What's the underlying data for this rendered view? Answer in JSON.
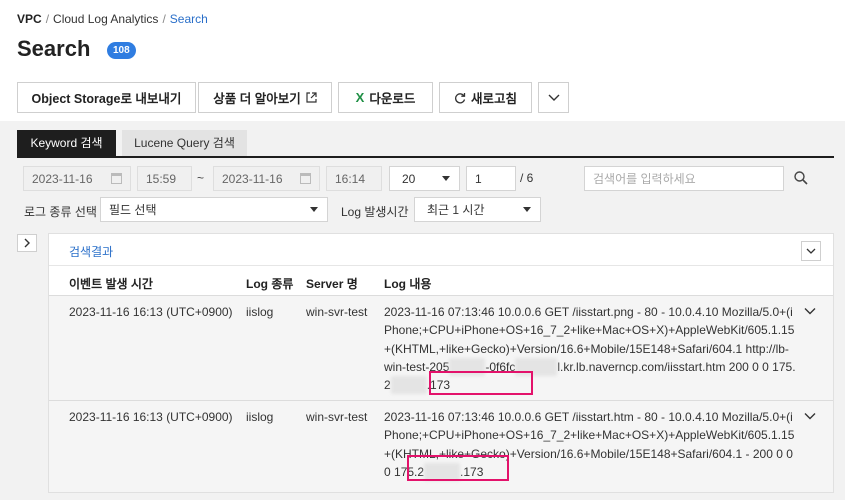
{
  "breadcrumb": {
    "root": "VPC",
    "service": "Cloud Log Analytics",
    "current": "Search"
  },
  "page": {
    "title": "Search",
    "count": "108"
  },
  "toolbar": {
    "export": "Object Storage로 내보내기",
    "learn_more": "상품 더 알아보기",
    "download_icon_letter": "X",
    "download": "다운로드",
    "refresh": "새로고침"
  },
  "tabs": [
    {
      "label": "Keyword 검색",
      "active": true
    },
    {
      "label": "Lucene Query 검색",
      "active": false
    }
  ],
  "filters": {
    "start_date": "2023-11-16",
    "start_time": "15:59",
    "range_sep": "~",
    "end_date": "2023-11-16",
    "end_time": "16:14",
    "page_size": "20",
    "page": "1",
    "total_pages": "/ 6",
    "search_placeholder": "검색어를 입력하세요",
    "log_type_label": "로그 종류 선택",
    "field_select": "필드 선택",
    "time_label": "Log 발생시간",
    "time_select": "최근 1 시간"
  },
  "results": {
    "title": "검색결과",
    "columns": [
      "이벤트 발생 시간",
      "Log 종류",
      "Server 명",
      "Log 내용"
    ],
    "rows": [
      {
        "time": "2023-11-16 16:13 (UTC+0900)",
        "log_type": "iislog",
        "server": "win-svr-test",
        "log_main": "2023-11-16 07:13:46 10.0.0.6 GET /iisstart.png - 80 - 10.0.4.10 Mozilla/5.0+(iPhone;+CPU+iPhone+OS+16_7_2+like+Mac+OS+X)+AppleWebKit/605.1.15+(KHTML,+like+Gecko)+Version/16.6+Mobile/15E148+Safari/604.1 ",
        "url_a": "http://lb-win-test-205",
        "url_b": "-0f6fc",
        "url_c": "l.kr.lb.naverncp.com/iisstart.htm",
        "status": "200 0 0 ",
        "ip_a": "175.2",
        "ip_b": ".173"
      },
      {
        "time": "2023-11-16 16:13 (UTC+0900)",
        "log_type": "iislog",
        "server": "win-svr-test",
        "log_main": "2023-11-16 07:13:46 10.0.0.6 GET /iisstart.htm - 80 - 10.0.4.10 Mozilla/5.0+(iPhone;+CPU+iPhone+OS+16_7_2+like+Mac+OS+X)+AppleWebKit/605.1.15+(KHTML,+like+Gecko)+Version/16.6+Mobile/15E148+Safari/604.1 - 200 ",
        "status": "0 0 0 ",
        "ip_a": "175.2",
        "ip_b": ".173"
      }
    ]
  },
  "colors": {
    "accent": "#2f7de1",
    "highlight": "#e3126b",
    "tab_active": "#1e1e1e"
  }
}
